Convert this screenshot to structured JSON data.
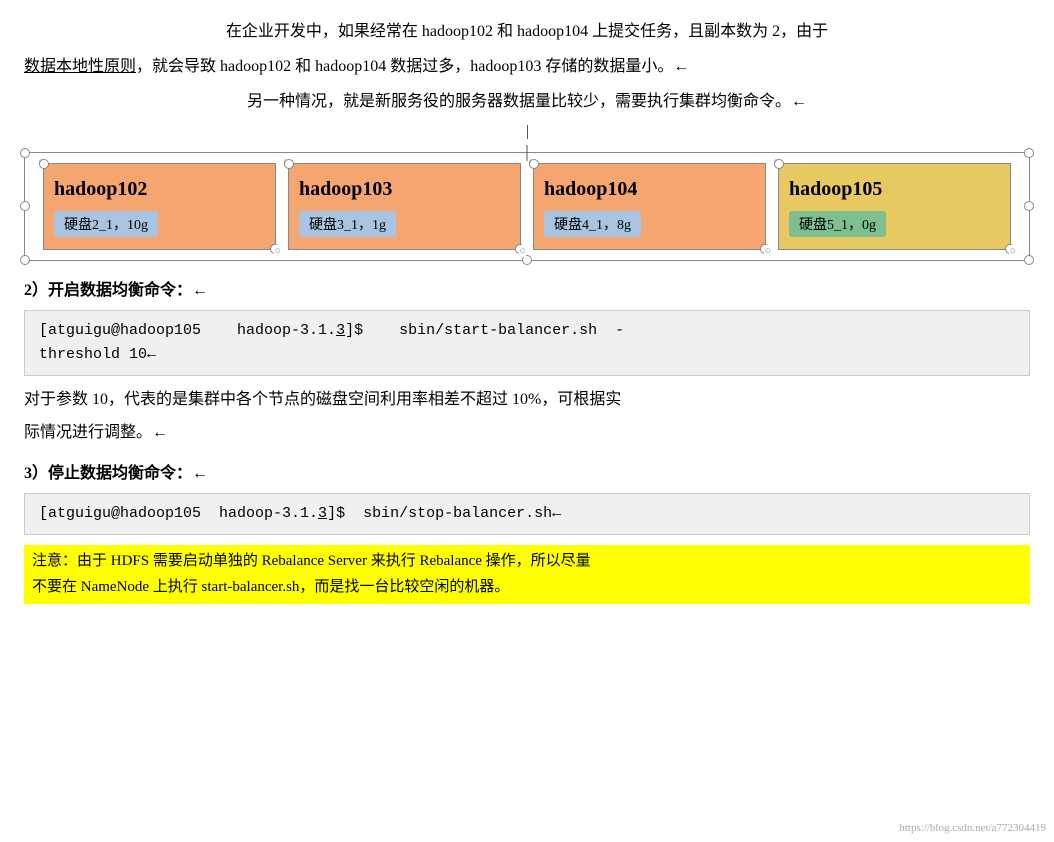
{
  "intro": {
    "line1": "在企业开发中，如果经常在 hadoop102 和 hadoop104 上提交任务，且副本数为 2，由于",
    "line2_underline": "数据本地性原则",
    "line2_rest": "，就会导致 hadoop102 和 hadoop104 数据过多，hadoop103 存储的数据量小。←",
    "line3": "另一种情况，就是新服务役的服务器数据量比较少，需要执行集群均衡命令。←"
  },
  "nodes": [
    {
      "id": "hadoop102",
      "name": "hadoop102",
      "disk_label": "硬盘2_1，10g",
      "disk_color": "blue",
      "color_class": "node-hadoop102"
    },
    {
      "id": "hadoop103",
      "name": "hadoop103",
      "disk_label": "硬盘3_1，1g",
      "disk_color": "blue",
      "color_class": "node-hadoop103"
    },
    {
      "id": "hadoop104",
      "name": "hadoop104",
      "disk_label": "硬盘4_1，8g",
      "disk_color": "blue",
      "color_class": "node-hadoop104"
    },
    {
      "id": "hadoop105",
      "name": "hadoop105",
      "disk_label": "硬盘5_1，0g",
      "disk_color": "green",
      "color_class": "node-hadoop105"
    }
  ],
  "section2": {
    "heading": "2）开启数据均衡命令：←",
    "code": "[atguigu@hadoop105    hadoop-3.1.",
    "code_link": "3",
    "code_after": "]$    sbin/start-balancer.sh  -\nthreshold 10←",
    "desc1": "对于参数 10，代表的是集群中各个节点的磁盘空间利用率相差不超过 10%，可根据实",
    "desc2": "际情况进行调整。←"
  },
  "section3": {
    "heading": "3）停止数据均衡命令：←",
    "code": "[atguigu@hadoop105  hadoop-3.1.",
    "code_link": "3",
    "code_after": "]$  sbin/stop-balancer.sh←",
    "warning": "注意：由于 HDFS 需要启动单独的 Rebalance Server 来执行 Rebalance 操作，所以尽量\n不要在 NameNode 上执行 start-balancer.sh，而是找一台比较空闲的机器。"
  },
  "watermark": "https://blog.csdn.net/a772304419"
}
